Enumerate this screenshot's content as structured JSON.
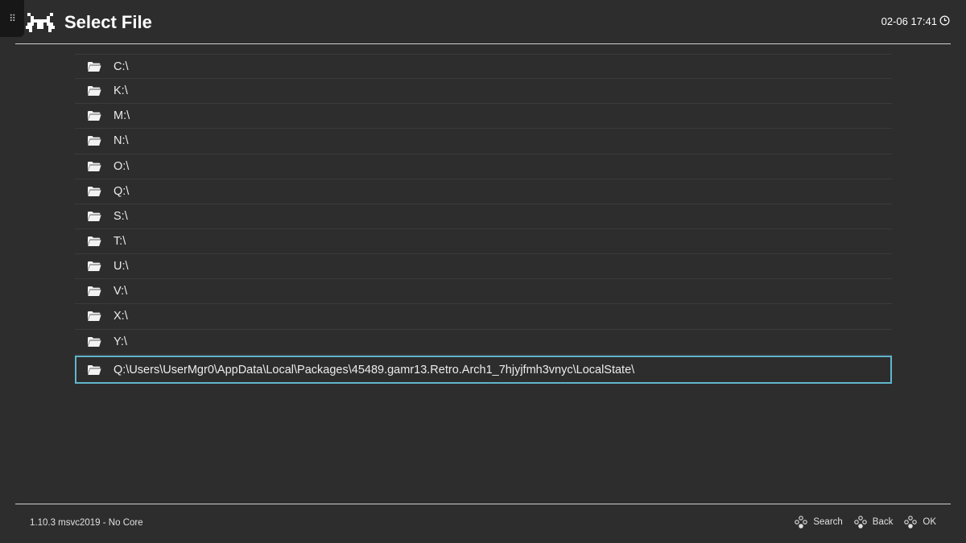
{
  "header": {
    "title": "Select File",
    "clock": "02-06 17:41",
    "logo_icon": "retroarch-invader-icon",
    "clock_icon": "clock-icon"
  },
  "list": {
    "items": [
      {
        "label": "C:\\",
        "icon": "folder-icon"
      },
      {
        "label": "K:\\",
        "icon": "folder-icon"
      },
      {
        "label": "M:\\",
        "icon": "folder-icon"
      },
      {
        "label": "N:\\",
        "icon": "folder-icon"
      },
      {
        "label": "O:\\",
        "icon": "folder-icon"
      },
      {
        "label": "Q:\\",
        "icon": "folder-icon"
      },
      {
        "label": "S:\\",
        "icon": "folder-icon"
      },
      {
        "label": "T:\\",
        "icon": "folder-icon"
      },
      {
        "label": "U:\\",
        "icon": "folder-icon"
      },
      {
        "label": "V:\\",
        "icon": "folder-icon"
      },
      {
        "label": "X:\\",
        "icon": "folder-icon"
      },
      {
        "label": "Y:\\",
        "icon": "folder-icon"
      },
      {
        "label": "Q:\\Users\\UserMgr0\\AppData\\Local\\Packages\\45489.gamr13.Retro.Arch1_7hjyjfmh3vnyc\\LocalState\\",
        "icon": "folder-icon",
        "selected": true
      }
    ]
  },
  "footer": {
    "version": "1.10.3 msvc2019 - No Core",
    "hints": [
      {
        "label": "Search",
        "icon": "gamepad-button-icon"
      },
      {
        "label": "Back",
        "icon": "gamepad-button-icon"
      },
      {
        "label": "OK",
        "icon": "gamepad-button-icon"
      }
    ]
  },
  "colors": {
    "background": "#2d2d2d",
    "selection_border": "#5fb6cc",
    "text": "#ececec"
  }
}
